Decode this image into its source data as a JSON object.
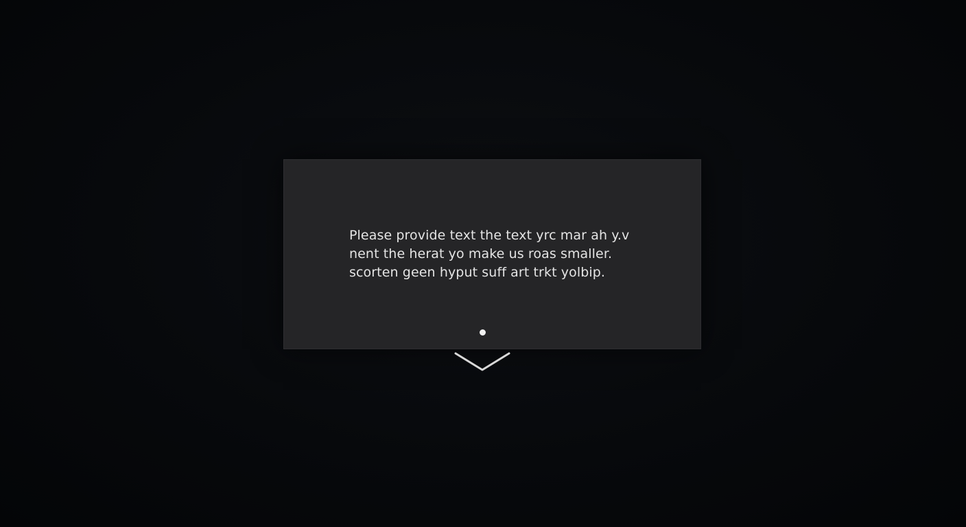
{
  "dialog": {
    "lines": [
      "Please provide text the text yrc mar ah y.v",
      "nent the herat yo make us roas smaller.",
      "scorten geen hyput suff art trkt yolbip."
    ]
  },
  "icons": {
    "indicator": "page-indicator-dot",
    "expand": "chevron-down-icon"
  },
  "colors": {
    "background": "#06080b",
    "dialog": "#252527",
    "text": "#e4e4e4",
    "accent": "#f2f2f2"
  }
}
